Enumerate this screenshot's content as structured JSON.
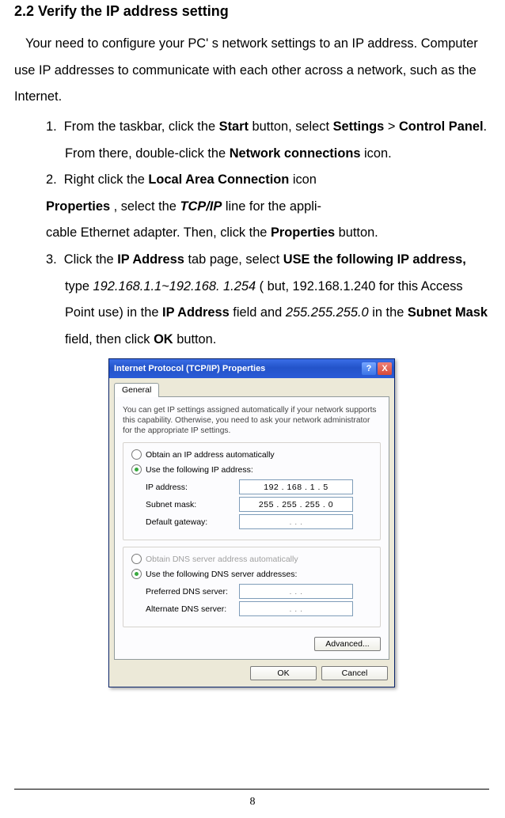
{
  "heading": "2.2    Verify the IP address setting",
  "intro": "Your need to configure your PC' s network settings to an IP address. Computer use IP addresses to communicate with each other across a network, such as the Internet.",
  "steps": {
    "s1": {
      "num": "1.",
      "pre": "From the taskbar, click the ",
      "b1": "Start",
      "mid1": " button, select ",
      "b2": "Settings",
      "mid2": " > ",
      "b3": "Control Panel",
      "mid3": ". From there, double-click the ",
      "b4": "Network connections",
      "post": " icon."
    },
    "s2": {
      "num": "2.",
      "pre": "Right click the ",
      "b1": "Local Area Connection",
      "mid1": " icon ",
      "b2": "Properties",
      "mid2": " , select the ",
      "bi": "TCP/IP",
      "mid3": " line for the appli-",
      "line2a": "cable Ethernet adapter. Then, click the ",
      "b3": "Properties",
      "line2b": " button."
    },
    "s3": {
      "num": "3.",
      "pre": "Click the ",
      "b1": "IP Address",
      "mid1": " tab page, select ",
      "b2": "USE the following IP address,",
      "mid2": " type ",
      "i1": "192.168.1.1~192.168. 1.254",
      "mid3": " ( but, 192.168.1.240 for this Access Point use) in the ",
      "b3": "IP Address",
      "mid4": " field and ",
      "i2": "255.255.255.0",
      "mid5": " in the ",
      "b4": "Subnet Mask",
      "mid6": " field, then click ",
      "b5": "OK",
      "post": " button."
    }
  },
  "dialog": {
    "title": "Internet Protocol (TCP/IP) Properties",
    "help_glyph": "?",
    "close_glyph": "X",
    "tab": "General",
    "desc": "You can get IP settings assigned automatically if your network supports this capability. Otherwise, you need to ask your network administrator for the appropriate IP settings.",
    "radio_ip_auto": "Obtain an IP address automatically",
    "radio_ip_manual": "Use the following IP address:",
    "fields_ip": {
      "addr_label": "IP address:",
      "addr_value": "192 . 168 .  1  .  5",
      "mask_label": "Subnet mask:",
      "mask_value": "255 . 255 . 255 .  0",
      "gw_label": "Default gateway:",
      "gw_value": ".        .        ."
    },
    "radio_dns_auto": "Obtain DNS server address automatically",
    "radio_dns_manual": "Use the following DNS server addresses:",
    "fields_dns": {
      "pref_label": "Preferred DNS server:",
      "pref_value": ".        .        .",
      "alt_label": "Alternate DNS server:",
      "alt_value": ".        .        ."
    },
    "btn_advanced": "Advanced...",
    "btn_ok": "OK",
    "btn_cancel": "Cancel"
  },
  "page_number": "8"
}
